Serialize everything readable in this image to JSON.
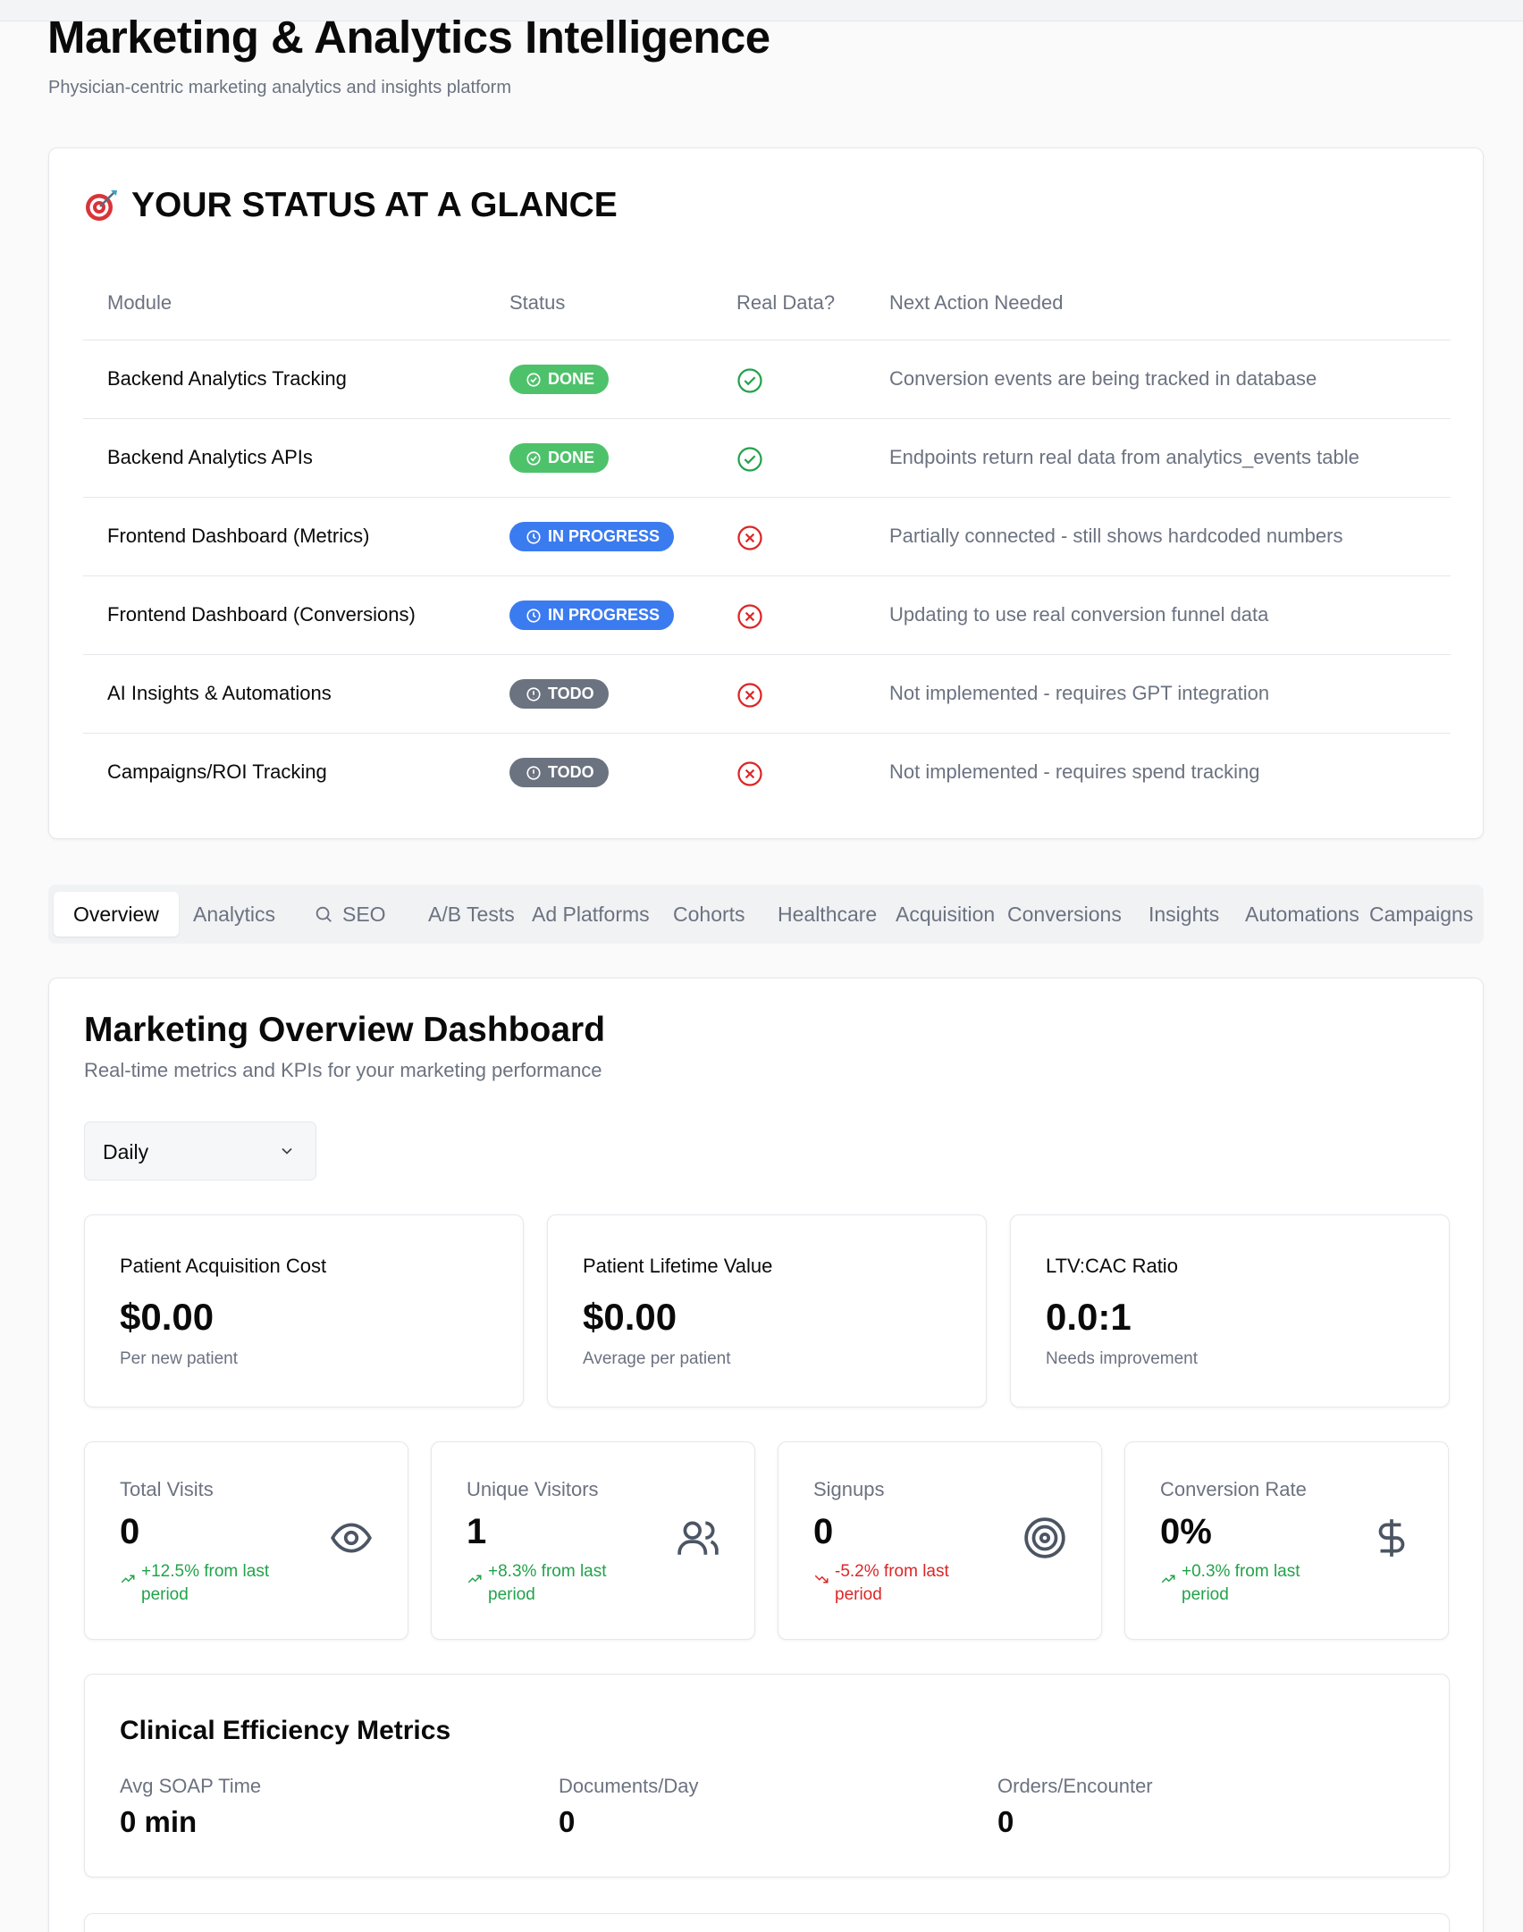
{
  "header": {
    "title": "Marketing & Analytics Intelligence",
    "subtitle": "Physician-centric marketing analytics and insights platform"
  },
  "status_section": {
    "heading": "YOUR STATUS AT A GLANCE",
    "heading_icon": "target-icon",
    "columns": [
      "Module",
      "Status",
      "Real Data?",
      "Next Action Needed"
    ],
    "rows": [
      {
        "module": "Backend Analytics Tracking",
        "status": "DONE",
        "status_type": "done",
        "real_data": true,
        "action": "Conversion events are being tracked in database"
      },
      {
        "module": "Backend Analytics APIs",
        "status": "DONE",
        "status_type": "done",
        "real_data": true,
        "action": "Endpoints return real data from analytics_events table"
      },
      {
        "module": "Frontend Dashboard (Metrics)",
        "status": "IN PROGRESS",
        "status_type": "progress",
        "real_data": false,
        "action": "Partially connected - still shows hardcoded numbers"
      },
      {
        "module": "Frontend Dashboard (Conversions)",
        "status": "IN PROGRESS",
        "status_type": "progress",
        "real_data": false,
        "action": "Updating to use real conversion funnel data"
      },
      {
        "module": "AI Insights & Automations",
        "status": "TODO",
        "status_type": "todo",
        "real_data": false,
        "action": "Not implemented - requires GPT integration"
      },
      {
        "module": "Campaigns/ROI Tracking",
        "status": "TODO",
        "status_type": "todo",
        "real_data": false,
        "action": "Not implemented - requires spend tracking"
      }
    ],
    "colors": {
      "done": "#4ec26a",
      "progress": "#3b7bf0",
      "todo": "#6b7280",
      "check": "#22a34a",
      "cross": "#dc2626"
    }
  },
  "tabs": [
    {
      "label": "Overview",
      "active": true
    },
    {
      "label": "Analytics"
    },
    {
      "label": "SEO",
      "icon": "search-icon"
    },
    {
      "label": "A/B Tests"
    },
    {
      "label": "Ad Platforms"
    },
    {
      "label": "Cohorts"
    },
    {
      "label": "Healthcare"
    },
    {
      "label": "Acquisition"
    },
    {
      "label": "Conversions"
    },
    {
      "label": "Insights"
    },
    {
      "label": "Automations"
    },
    {
      "label": "Campaigns"
    }
  ],
  "overview": {
    "title": "Marketing Overview Dashboard",
    "subtitle": "Real-time metrics and KPIs for your marketing performance",
    "period_select": {
      "value": "Daily"
    },
    "kpis": [
      {
        "label": "Patient Acquisition Cost",
        "value": "$0.00",
        "caption": "Per new patient"
      },
      {
        "label": "Patient Lifetime Value",
        "value": "$0.00",
        "caption": "Average per patient"
      },
      {
        "label": "LTV:CAC Ratio",
        "value": "0.0:1",
        "caption": "Needs improvement"
      }
    ],
    "stats": [
      {
        "label": "Total Visits",
        "value": "0",
        "change": "+12.5% from last period",
        "direction": "up",
        "icon": "eye-icon"
      },
      {
        "label": "Unique Visitors",
        "value": "1",
        "change": "+8.3% from last period",
        "direction": "up",
        "icon": "users-icon"
      },
      {
        "label": "Signups",
        "value": "0",
        "change": "-5.2% from last period",
        "direction": "down",
        "icon": "target-icon"
      },
      {
        "label": "Conversion Rate",
        "value": "0%",
        "change": "+0.3% from last period",
        "direction": "up",
        "icon": "dollar-icon"
      }
    ],
    "clinical": {
      "title": "Clinical Efficiency Metrics",
      "items": [
        {
          "label": "Avg SOAP Time",
          "value": "0 min"
        },
        {
          "label": "Documents/Day",
          "value": "0"
        },
        {
          "label": "Orders/Encounter",
          "value": "0"
        }
      ]
    }
  }
}
